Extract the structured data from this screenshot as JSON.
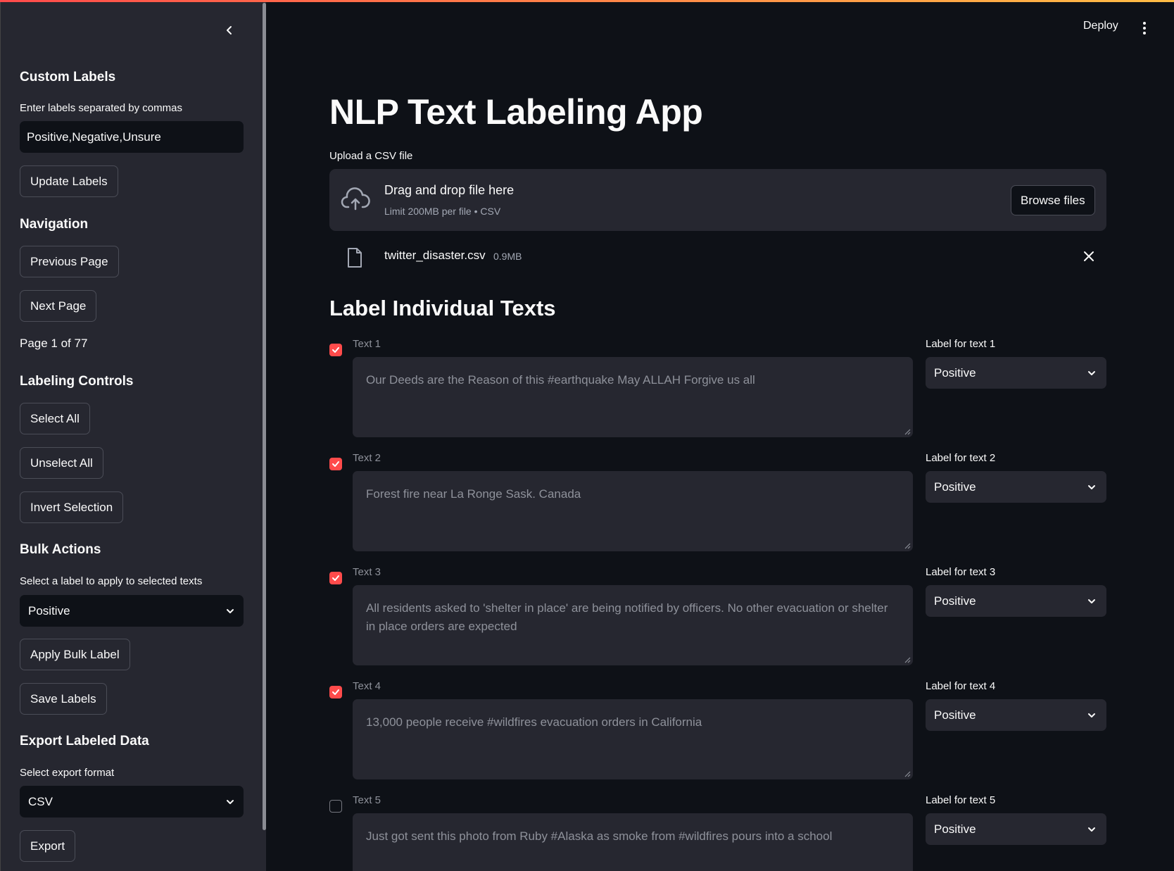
{
  "sidebar": {
    "custom_labels_heading": "Custom Labels",
    "labels_input_label": "Enter labels separated by commas",
    "labels_input_value": "Positive,Negative,Unsure",
    "update_labels_button": "Update Labels",
    "navigation_heading": "Navigation",
    "previous_page_button": "Previous Page",
    "next_page_button": "Next Page",
    "page_indicator": "Page 1 of 77",
    "labeling_controls_heading": "Labeling Controls",
    "select_all_button": "Select All",
    "unselect_all_button": "Unselect All",
    "invert_selection_button": "Invert Selection",
    "bulk_actions_heading": "Bulk Actions",
    "bulk_select_label": "Select a label to apply to selected texts",
    "bulk_select_value": "Positive",
    "apply_bulk_button": "Apply Bulk Label",
    "save_labels_button": "Save Labels",
    "export_heading": "Export Labeled Data",
    "export_format_label": "Select export format",
    "export_format_value": "CSV",
    "export_button": "Export"
  },
  "header": {
    "deploy_label": "Deploy",
    "menu_icon": "kebab-menu-icon"
  },
  "main": {
    "title": "NLP Text Labeling App",
    "upload_label": "Upload a CSV file",
    "dropzone_title": "Drag and drop file here",
    "dropzone_subtitle": "Limit 200MB per file • CSV",
    "browse_button": "Browse files",
    "uploaded_file_name": "twitter_disaster.csv",
    "uploaded_file_size": "0.9MB",
    "section_title": "Label Individual Texts",
    "texts": [
      {
        "label": "Text 1",
        "checked": true,
        "content": "Our Deeds are the Reason of this #earthquake May ALLAH Forgive us all",
        "select_label": "Label for text 1",
        "select_value": "Positive"
      },
      {
        "label": "Text 2",
        "checked": true,
        "content": "Forest fire near La Ronge Sask. Canada",
        "select_label": "Label for text 2",
        "select_value": "Positive"
      },
      {
        "label": "Text 3",
        "checked": true,
        "content": "All residents asked to 'shelter in place' are being notified by officers. No other evacuation or shelter in place orders are expected",
        "select_label": "Label for text 3",
        "select_value": "Positive"
      },
      {
        "label": "Text 4",
        "checked": true,
        "content": "13,000 people receive #wildfires evacuation orders in California",
        "select_label": "Label for text 4",
        "select_value": "Positive"
      },
      {
        "label": "Text 5",
        "checked": false,
        "content": "Just got sent this photo from Ruby #Alaska as smoke from #wildfires pours into a school",
        "select_label": "Label for text 5",
        "select_value": "Positive"
      }
    ]
  },
  "colors": {
    "accent": "#ff4b4b",
    "background": "#0e1117",
    "sidebar": "#262730"
  }
}
